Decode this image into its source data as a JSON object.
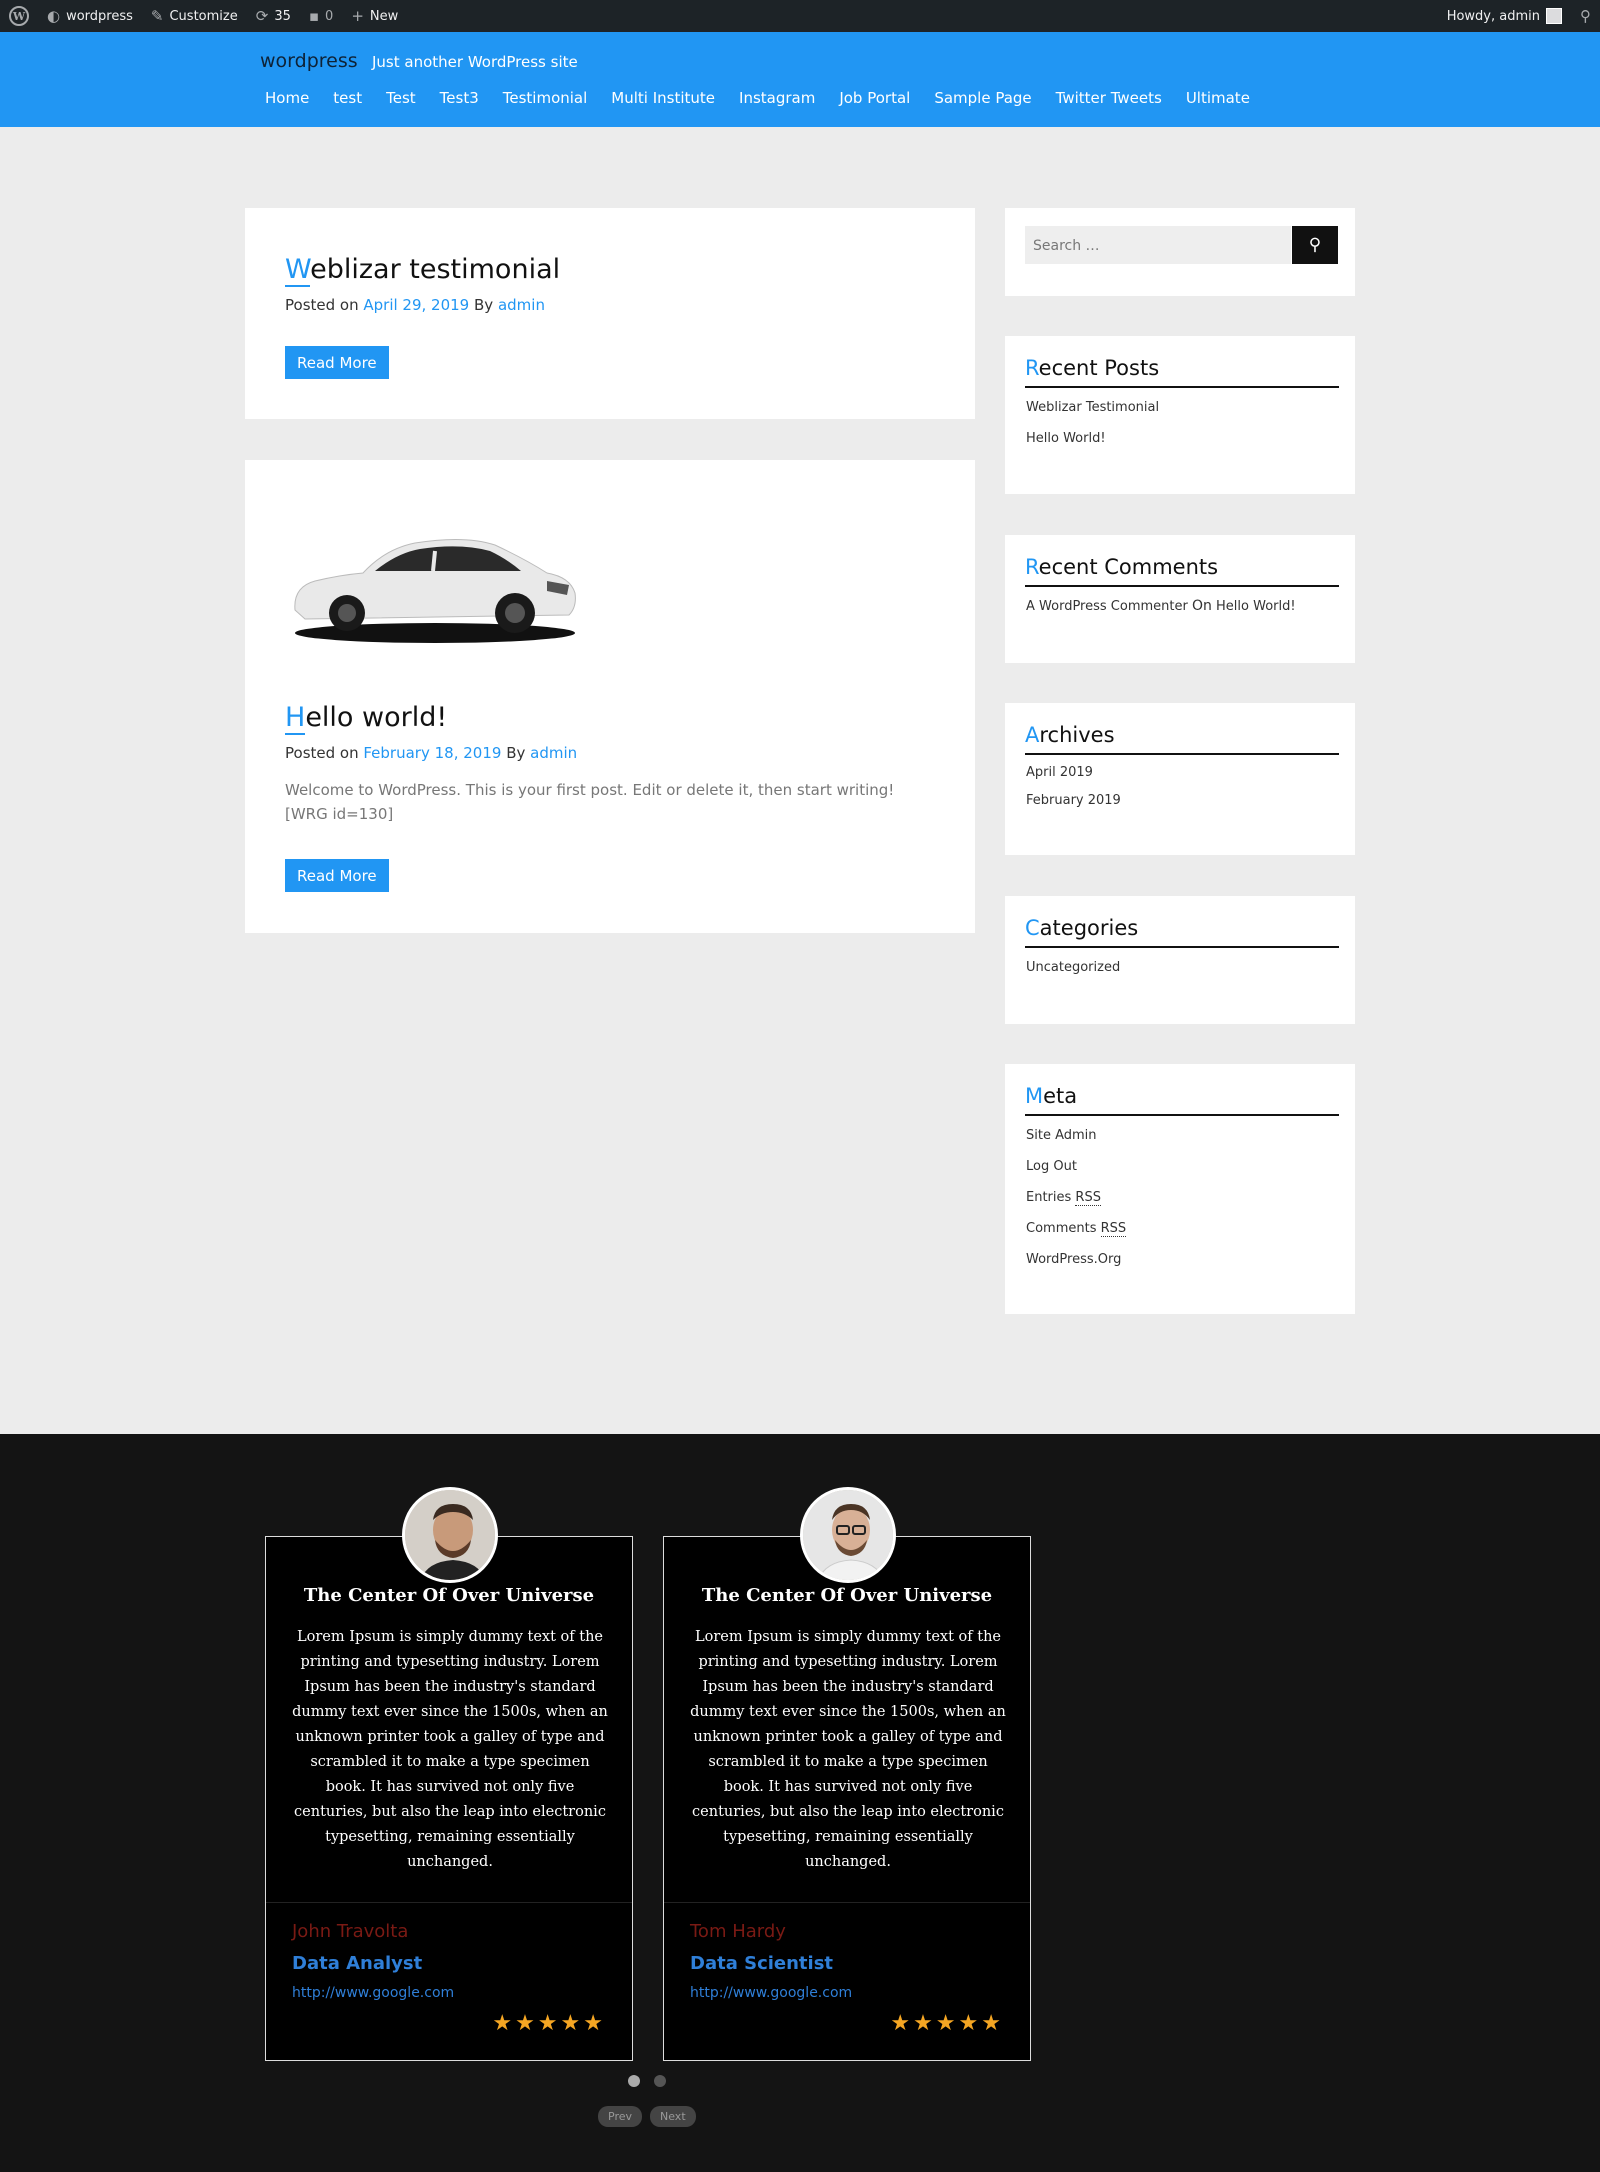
{
  "adminbar": {
    "site": "wordpress",
    "customize": "Customize",
    "updates": "35",
    "comments": "0",
    "new": "New",
    "howdy": "Howdy, admin"
  },
  "header": {
    "site_title": "wordpress",
    "tagline": "Just another WordPress site",
    "nav": [
      "Home",
      "test",
      "Test",
      "Test3",
      "Testimonial",
      "Multi Institute",
      "Instagram",
      "Job Portal",
      "Sample Page",
      "Twitter Tweets",
      "Ultimate"
    ]
  },
  "posts": [
    {
      "title_first": "W",
      "title_rest": "eblizar testimonial",
      "posted_on": "Posted on",
      "date": "April 29, 2019",
      "by": "By",
      "author": "admin",
      "read_more": "Read More"
    },
    {
      "title_first": "H",
      "title_rest": "ello world!",
      "posted_on": "Posted on",
      "date": "February 18, 2019",
      "by": "By",
      "author": "admin",
      "excerpt": "Welcome to WordPress. This is your first post. Edit or delete it, then start writing! [WRG id=130]",
      "read_more": "Read More"
    }
  ],
  "sidebar": {
    "search_placeholder": "Search …",
    "recent_posts": {
      "title_first": "R",
      "title_rest": "ecent Posts",
      "items": [
        "Weblizar Testimonial",
        "Hello World!"
      ]
    },
    "recent_comments": {
      "title_first": "R",
      "title_rest": "ecent Comments",
      "author": "A WordPress Commenter",
      "on": "On",
      "post": "Hello World!"
    },
    "archives": {
      "title_first": "A",
      "title_rest": "rchives",
      "items": [
        "April 2019",
        "February 2019"
      ]
    },
    "categories": {
      "title_first": "C",
      "title_rest": "ategories",
      "items": [
        "Uncategorized"
      ]
    },
    "meta": {
      "title_first": "M",
      "title_rest": "eta",
      "site_admin": "Site Admin",
      "log_out": "Log Out",
      "entries": "Entries",
      "comments": "Comments",
      "rss": "RSS",
      "wp_org": "WordPress.Org"
    }
  },
  "testimonials": [
    {
      "title": "The Center Of Over Universe",
      "text": "Lorem Ipsum is simply dummy text of the printing and typesetting industry. Lorem Ipsum has been the industry's standard dummy text ever since the 1500s, when an unknown printer took a galley of type and scrambled it to make a type specimen book. It has survived not only five centuries, but also the leap into electronic typesetting, remaining essentially unchanged.",
      "name": "John Travolta",
      "role": "Data Analyst",
      "link": "http://www.google.com",
      "rating": 5
    },
    {
      "title": "The Center Of Over Universe",
      "text": "Lorem Ipsum is simply dummy text of the printing and typesetting industry. Lorem Ipsum has been the industry's standard dummy text ever since the 1500s, when an unknown printer took a galley of type and scrambled it to make a type specimen book. It has survived not only five centuries, but also the leap into electronic typesetting, remaining essentially unchanged.",
      "name": "Tom Hardy",
      "role": "Data Scientist",
      "link": "http://www.google.com",
      "rating": 5
    }
  ],
  "slider": {
    "prev": "Prev",
    "next": "Next"
  },
  "colors": {
    "accent": "#2196f3",
    "adminbar": "#1d2327",
    "footer": "#141414",
    "star": "#f5a623"
  }
}
